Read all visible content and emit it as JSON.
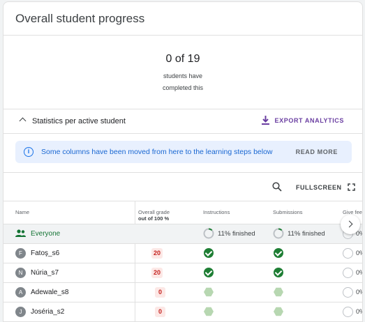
{
  "header": {
    "title": "Overall student progress"
  },
  "summary": {
    "count": "0 of 19",
    "line1": "students have",
    "line2": "completed this"
  },
  "stats": {
    "label": "Statistics per active student",
    "export_label": "EXPORT ANALYTICS"
  },
  "banner": {
    "text": "Some columns have been moved from here to the learning steps below",
    "action": "READ MORE"
  },
  "toolbar": {
    "fullscreen_label": "FULLSCREEN"
  },
  "table": {
    "columns": {
      "name": "Name",
      "grade": "Overall grade",
      "grade_sub": "out of 100 %",
      "instructions": "Instructions",
      "submissions": "Submissions",
      "give_feedback": "Give fee"
    },
    "everyone": {
      "label": "Everyone",
      "instructions": "11% finished",
      "submissions": "11% finished",
      "give_feedback": "0%"
    },
    "students": [
      {
        "initial": "F",
        "name": "Fatoş_s6",
        "grade": "20",
        "instructions": "done",
        "submissions": "done",
        "give_feedback": "0%"
      },
      {
        "initial": "N",
        "name": "Núria_s7",
        "grade": "20",
        "instructions": "done",
        "submissions": "done",
        "give_feedback": "0%"
      },
      {
        "initial": "A",
        "name": "Adewale_s8",
        "grade": "0",
        "instructions": "not-started",
        "submissions": "not-started",
        "give_feedback": "0%"
      },
      {
        "initial": "J",
        "name": "Joséria_s2",
        "grade": "0",
        "instructions": "not-started",
        "submissions": "not-started",
        "give_feedback": "0%"
      }
    ]
  },
  "colors": {
    "accent": "#6a3ea1",
    "info": "#1967d2",
    "success": "#1e7e34",
    "grade_bad": "#c5221f"
  }
}
